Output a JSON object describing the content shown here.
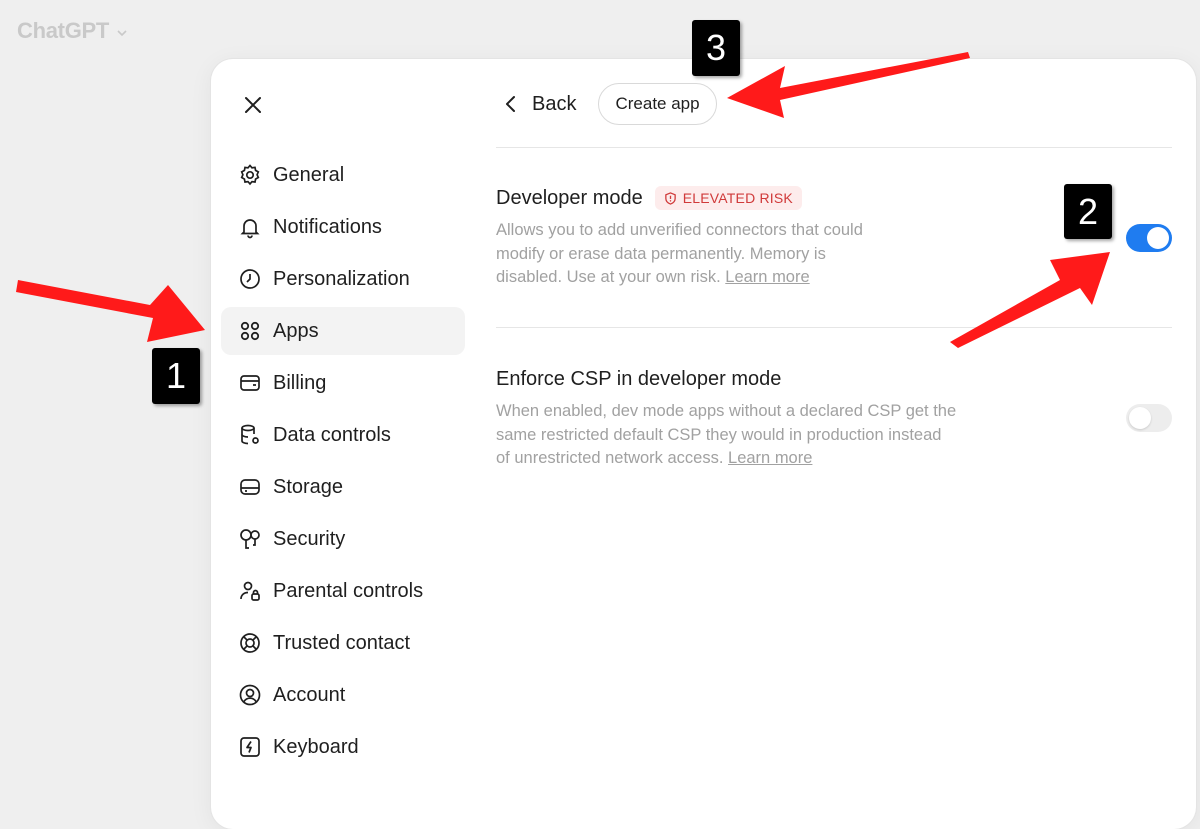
{
  "app": {
    "title": "ChatGPT"
  },
  "close_icon": "close-icon",
  "nav": [
    {
      "label": "General",
      "icon": "gear-icon"
    },
    {
      "label": "Notifications",
      "icon": "bell-icon"
    },
    {
      "label": "Personalization",
      "icon": "personalization-icon"
    },
    {
      "label": "Apps",
      "icon": "apps-grid-icon",
      "active": true
    },
    {
      "label": "Billing",
      "icon": "billing-card-icon"
    },
    {
      "label": "Data controls",
      "icon": "database-gear-icon"
    },
    {
      "label": "Storage",
      "icon": "storage-icon"
    },
    {
      "label": "Security",
      "icon": "key-icon"
    },
    {
      "label": "Parental controls",
      "icon": "person-lock-icon"
    },
    {
      "label": "Trusted contact",
      "icon": "lifebuoy-icon"
    },
    {
      "label": "Account",
      "icon": "user-circle-icon"
    },
    {
      "label": "Keyboard",
      "icon": "keyboard-bolt-icon"
    }
  ],
  "topbar": {
    "back_label": "Back",
    "create_label": "Create app"
  },
  "developer_mode": {
    "title": "Developer mode",
    "badge": "ELEVATED RISK",
    "description": "Allows you to add unverified connectors that could modify or erase data permanently. Memory is disabled. Use at your own risk.",
    "learn_more": "Learn more",
    "enabled": true
  },
  "enforce_csp": {
    "title": "Enforce CSP in developer mode",
    "description": "When enabled, dev mode apps without a declared CSP get the same restricted default CSP they would in production instead of unrestricted network access.",
    "learn_more": "Learn more",
    "enabled": false
  },
  "annotations": {
    "marker_1": "1",
    "marker_2": "2",
    "marker_3": "3"
  },
  "colors": {
    "accent": "#1f7cf0",
    "risk": "#d03a3a",
    "arrow": "#ff1a1a"
  }
}
